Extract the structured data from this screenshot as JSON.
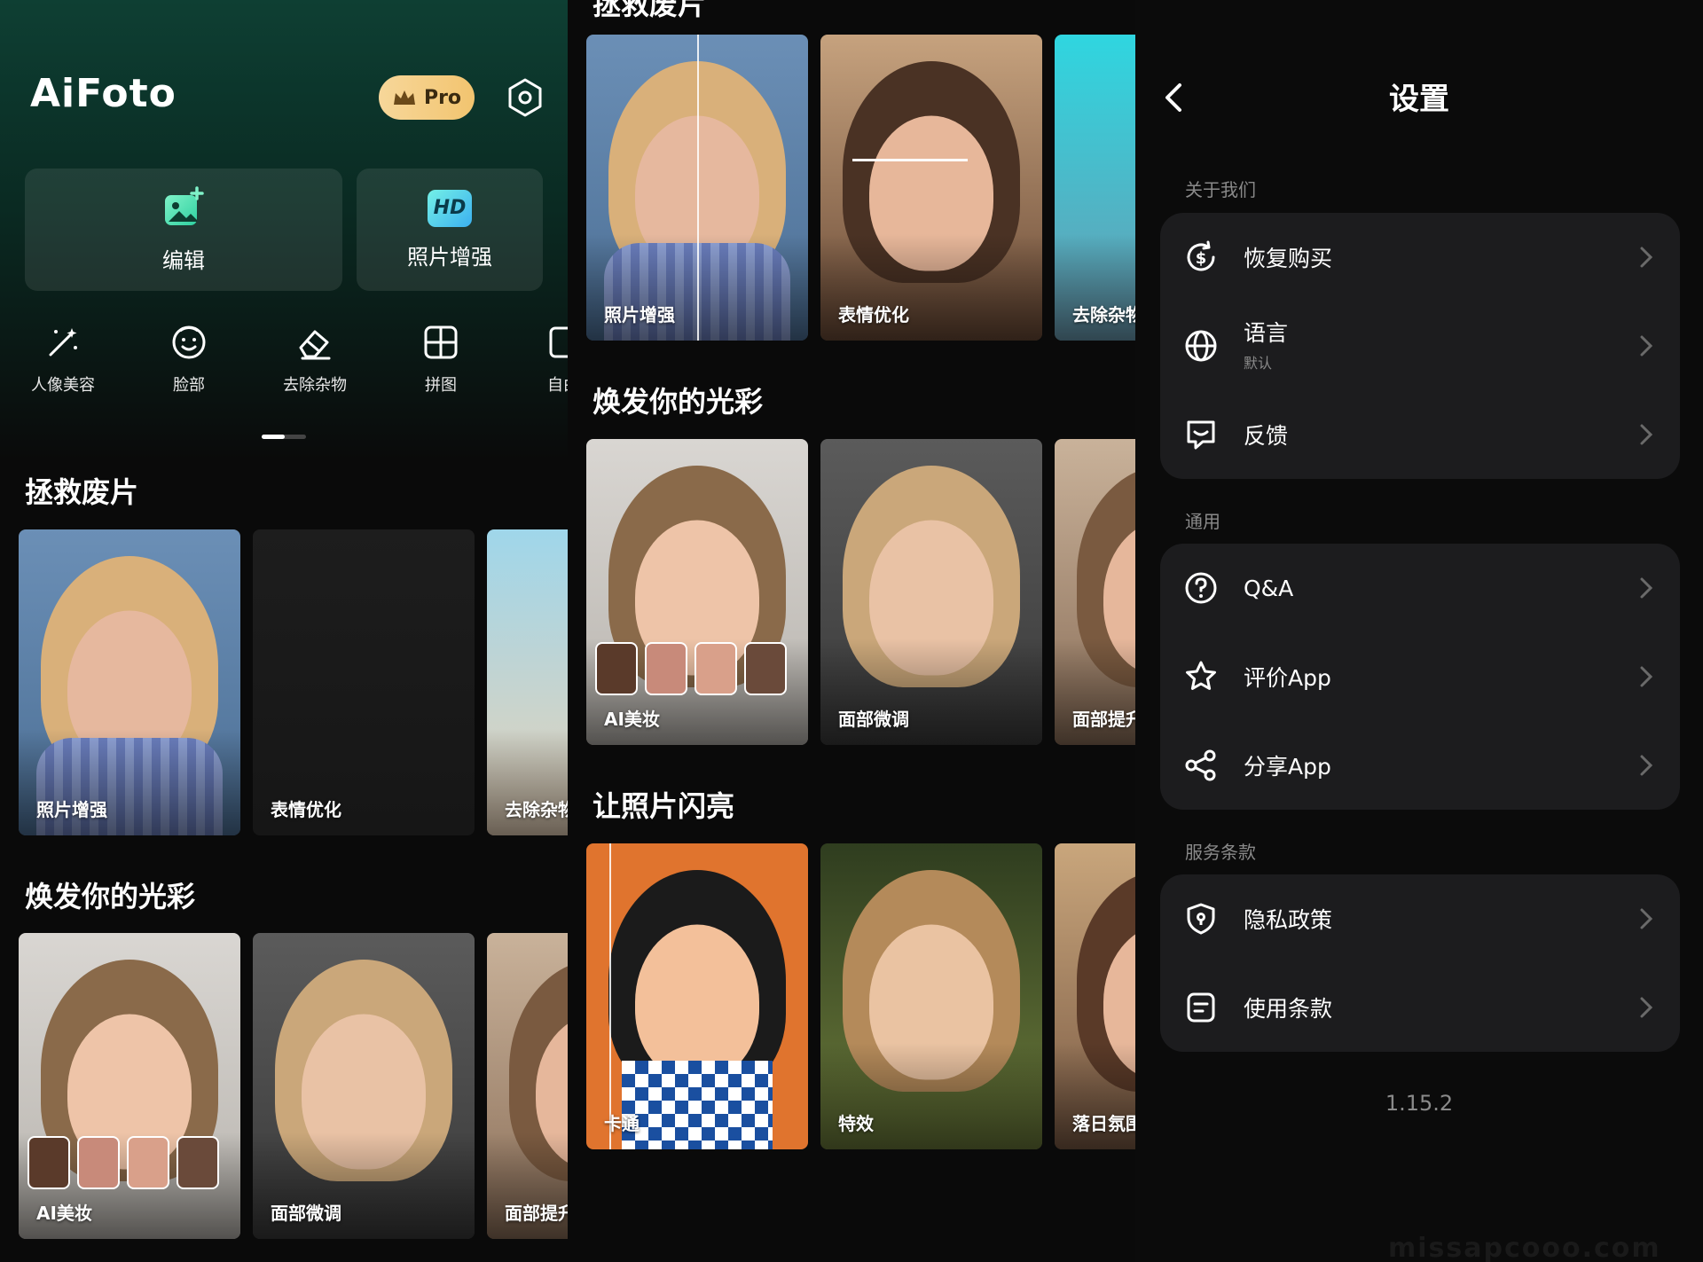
{
  "home": {
    "app_name": "AiFoto",
    "pro_label": "Pro",
    "cards": {
      "edit": "编辑",
      "hd_badge": "HD",
      "enhance": "照片增强"
    },
    "tools": [
      "人像美容",
      "脸部",
      "去除杂物",
      "拼图",
      "自由"
    ],
    "sections": {
      "rescue": "拯救废片",
      "glow": "焕发你的光彩"
    },
    "rescue_tiles": [
      "照片增强",
      "表情优化",
      "去除杂物"
    ],
    "glow_tiles": [
      "AI美妆",
      "面部微调",
      "面部提升"
    ]
  },
  "feed": {
    "partial_title": "拯救废片",
    "rescue_tiles": [
      "照片增强",
      "表情优化",
      "去除杂物"
    ],
    "glow_title": "焕发你的光彩",
    "glow_tiles": [
      "AI美妆",
      "面部微调",
      "面部提升"
    ],
    "shine_title": "让照片闪亮",
    "shine_tiles": [
      "卡通",
      "特效",
      "落日氛围"
    ]
  },
  "settings": {
    "title": "设置",
    "groups": [
      {
        "label": "关于我们",
        "items": [
          {
            "icon": "dollar-refresh-icon",
            "label": "恢复购买"
          },
          {
            "icon": "globe-icon",
            "label": "语言",
            "sub": "默认"
          },
          {
            "icon": "feedback-icon",
            "label": "反馈"
          }
        ]
      },
      {
        "label": "通用",
        "items": [
          {
            "icon": "question-icon",
            "label": "Q&A"
          },
          {
            "icon": "star-icon",
            "label": "评价App"
          },
          {
            "icon": "share-icon",
            "label": "分享App"
          }
        ]
      },
      {
        "label": "服务条款",
        "items": [
          {
            "icon": "shield-icon",
            "label": "隐私政策"
          },
          {
            "icon": "document-icon",
            "label": "使用条款"
          }
        ]
      }
    ],
    "version": "1.15.2",
    "watermark": "missapcooo.com"
  },
  "colors": {
    "accent_pro": "#f2c46f",
    "hero_green": "#0e3f33",
    "group_bg": "#1c1c1e"
  }
}
